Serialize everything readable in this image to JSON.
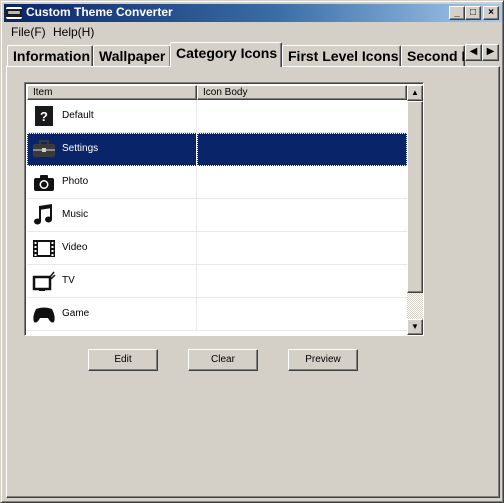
{
  "window": {
    "title": "Custom Theme Converter"
  },
  "caption_buttons": {
    "minimize": "_",
    "maximize": "□",
    "close": "×"
  },
  "menu": [
    {
      "label": "File(F)"
    },
    {
      "label": "Help(H)"
    }
  ],
  "tabs": [
    {
      "label": "Information",
      "active": false
    },
    {
      "label": "Wallpaper",
      "active": false
    },
    {
      "label": "Category Icons",
      "active": true
    },
    {
      "label": "First Level Icons",
      "active": false
    },
    {
      "label": "Second L",
      "active": false
    }
  ],
  "tab_scroll": {
    "left": "◀",
    "right": "▶"
  },
  "list": {
    "columns": [
      "Item",
      "Icon Body"
    ],
    "selected_index": 1,
    "rows": [
      {
        "label": "Default",
        "icon": "question-icon",
        "icon_body": ""
      },
      {
        "label": "Settings",
        "icon": "toolbox-icon",
        "icon_body": ""
      },
      {
        "label": "Photo",
        "icon": "camera-icon",
        "icon_body": ""
      },
      {
        "label": "Music",
        "icon": "music-note-icon",
        "icon_body": ""
      },
      {
        "label": "Video",
        "icon": "film-icon",
        "icon_body": ""
      },
      {
        "label": "TV",
        "icon": "tv-icon",
        "icon_body": ""
      },
      {
        "label": "Game",
        "icon": "gamepad-icon",
        "icon_body": ""
      }
    ],
    "scroll_up": "▲",
    "scroll_down": "▼"
  },
  "buttons": {
    "edit": "Edit",
    "clear": "Clear",
    "preview": "Preview"
  },
  "colors": {
    "selection": "#0a246a",
    "title_gradient_start": "#0a246a",
    "title_gradient_end": "#a6caf0",
    "face": "#d4d0c8"
  }
}
